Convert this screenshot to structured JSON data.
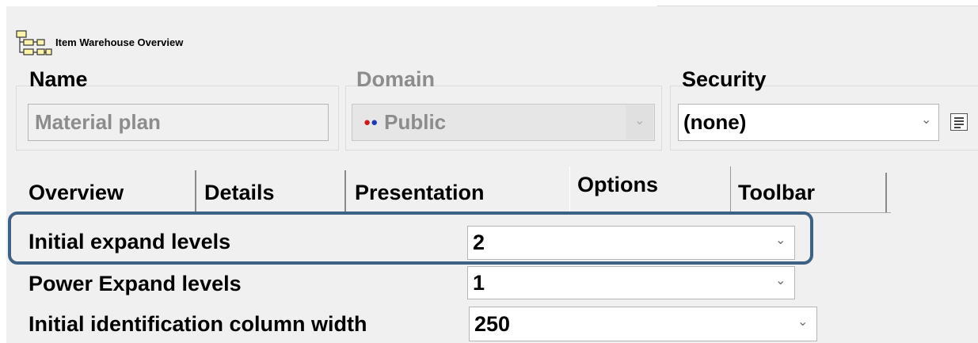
{
  "window": {
    "title": "Item Warehouse Overview",
    "icon": "tree-structure-icon"
  },
  "header": {
    "name": {
      "label": "Name",
      "value": "Material plan"
    },
    "domain": {
      "label": "Domain",
      "value": "Public",
      "icon": "people-icon"
    },
    "security": {
      "label": "Security",
      "value": "(none)"
    }
  },
  "tabs": [
    {
      "label": "Overview"
    },
    {
      "label": "Details"
    },
    {
      "label": "Presentation"
    },
    {
      "label": "Options",
      "active": true
    },
    {
      "label": "Toolbar"
    }
  ],
  "options": [
    {
      "label": "Initial expand levels",
      "value": "2",
      "highlighted": true
    },
    {
      "label": "Power Expand levels",
      "value": "1"
    },
    {
      "label": "Initial identification column width",
      "value": "250"
    }
  ],
  "colors": {
    "highlight_border": "#3e6286",
    "disabled_text": "#8c8c8c",
    "domain_icon_red": "#d01818",
    "domain_icon_blue": "#1a3ab8"
  }
}
